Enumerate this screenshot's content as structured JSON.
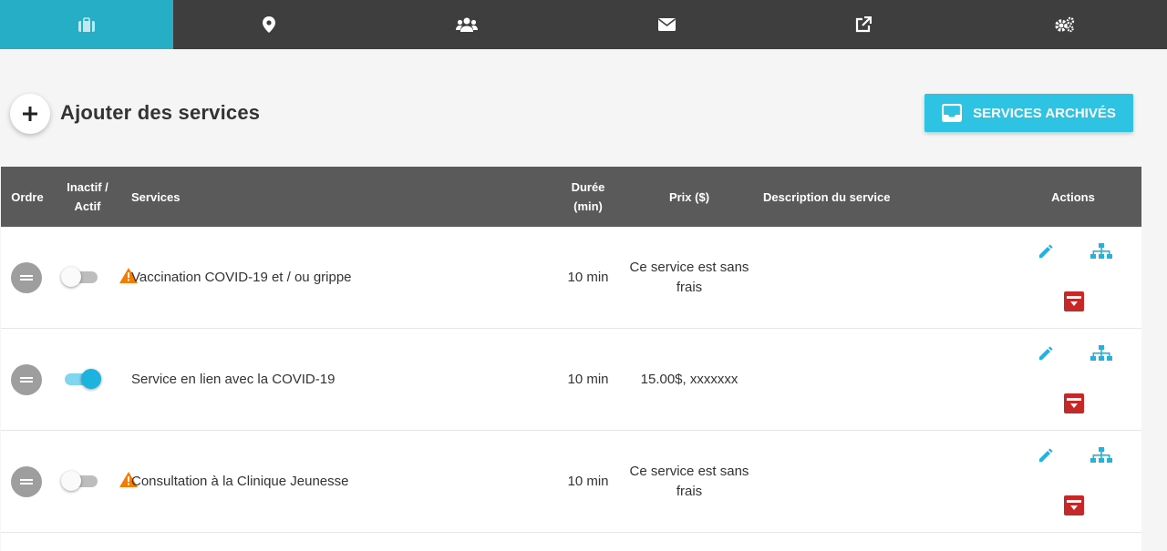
{
  "nav": {
    "tabs": [
      {
        "icon": "briefcase-icon",
        "active": true
      },
      {
        "icon": "map-marker-icon",
        "active": false
      },
      {
        "icon": "users-icon",
        "active": false
      },
      {
        "icon": "envelope-icon",
        "active": false
      },
      {
        "icon": "external-link-icon",
        "active": false
      },
      {
        "icon": "cogs-icon",
        "active": false
      }
    ],
    "active_color": "#26aec6",
    "bar_color": "#3e3e3e"
  },
  "header": {
    "add_title": "Ajouter des services",
    "archive_button_label": "SERVICES ARCHIVÉS"
  },
  "table": {
    "columns": {
      "order": "Ordre",
      "active_line1": "Inactif /",
      "active_line2": "Actif",
      "services": "Services",
      "duration_line1": "Durée",
      "duration_line2": "(min)",
      "price": "Prix ($)",
      "description": "Description du service",
      "actions": "Actions"
    },
    "rows": [
      {
        "active": false,
        "warning": true,
        "service": "Vaccination COVID-19 et / ou grippe",
        "duration": "10 min",
        "price": "Ce service est sans frais",
        "description": ""
      },
      {
        "active": true,
        "warning": false,
        "service": "Service en lien avec la COVID-19",
        "duration": "10 min",
        "price": "15.00$, xxxxxxx",
        "description": ""
      },
      {
        "active": false,
        "warning": true,
        "service": "Consultation à la Clinique Jeunesse",
        "duration": "10 min",
        "price": "Ce service est sans frais",
        "description": ""
      }
    ]
  },
  "colors": {
    "accent": "#2ec3e3",
    "archive_red": "#c62828",
    "warning_orange": "#f57c00"
  }
}
